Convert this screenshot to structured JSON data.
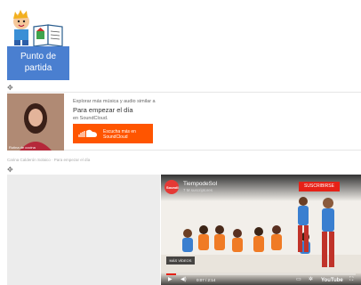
{
  "start_card": {
    "button_label": "Punto de partida"
  },
  "soundcloud": {
    "line1": "Explorar más música y audio similar a",
    "line2": "Para empezar el día",
    "line3": "en SoundCloud.",
    "button_line1": "Escucha más en",
    "button_line2": "SoundCloud",
    "art_caption": "Rutina de cocina",
    "attribution": "Carina Calderón Solaico · Para empezar el día",
    "brand_color": "#ff5500"
  },
  "youtube": {
    "avatar_text": "SoundI",
    "channel": "TiempodeSol",
    "subscribers": "7 M suscriptores",
    "subscribe_label": "SUSCRIBIRSE",
    "more_videos_label": "MÁS VÍDEOS",
    "time": "0:07 / 2:14",
    "progress": 0.05,
    "logo": "YouTube",
    "brand_color": "#e62117",
    "controls": [
      "play-icon",
      "volume-icon",
      "captions-icon",
      "gear-icon",
      "fullscreen-icon"
    ]
  }
}
